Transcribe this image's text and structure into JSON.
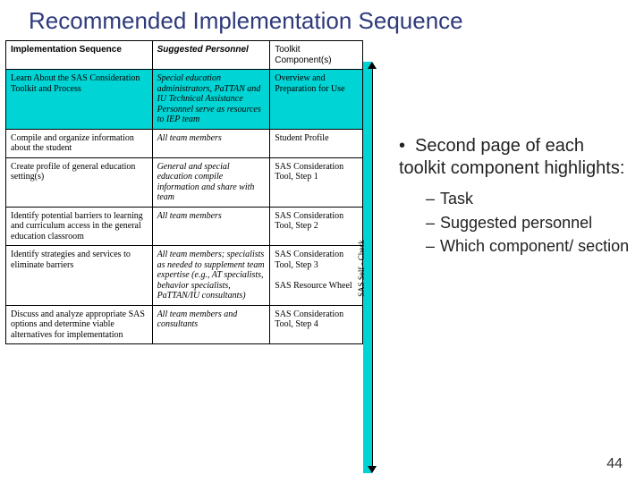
{
  "title": "Recommended Implementation Sequence",
  "table": {
    "headers": {
      "c1": "Implementation Sequence",
      "c2": "Suggested Personnel",
      "c3": "Toolkit Component(s)"
    },
    "rows": [
      {
        "c1": "Learn About the SAS Consideration Toolkit and Process",
        "c2": "Special education administrators, PaTTAN and IU Technical Assistance Personnel serve as resources to IEP team",
        "c3": "Overview and Preparation for Use",
        "hl": true
      },
      {
        "c1": "Compile and organize information about the student",
        "c2": "All team members",
        "c3": "Student Profile"
      },
      {
        "c1": "Create profile of general education setting(s)",
        "c2": "General and special education compile information and share with team",
        "c3": "SAS Consideration Tool, Step 1"
      },
      {
        "c1": "Identify potential barriers to learning and curriculum access in the general education classroom",
        "c2": "All team members",
        "c3": "SAS Consideration Tool, Step 2"
      },
      {
        "c1": "Identify strategies and services to eliminate barriers",
        "c2": "All team members; specialists as needed to supplement team expertise (e.g., AT specialists, behavior specialists, PaTTAN/IU consultants)",
        "c3": "SAS Consideration Tool, Step 3\n\nSAS Resource Wheel"
      },
      {
        "c1": "Discuss and analyze appropriate SAS options and determine viable alternatives for implementation",
        "c2": "All team members and consultants",
        "c3": "SAS Consideration Tool, Step 4"
      }
    ]
  },
  "side_label": "SAS Self - Check",
  "bullets": {
    "main": "Second page of each toolkit component highlights:",
    "subs": [
      "Task",
      "Suggested personnel",
      "Which component/ section"
    ]
  },
  "page_number": "44"
}
